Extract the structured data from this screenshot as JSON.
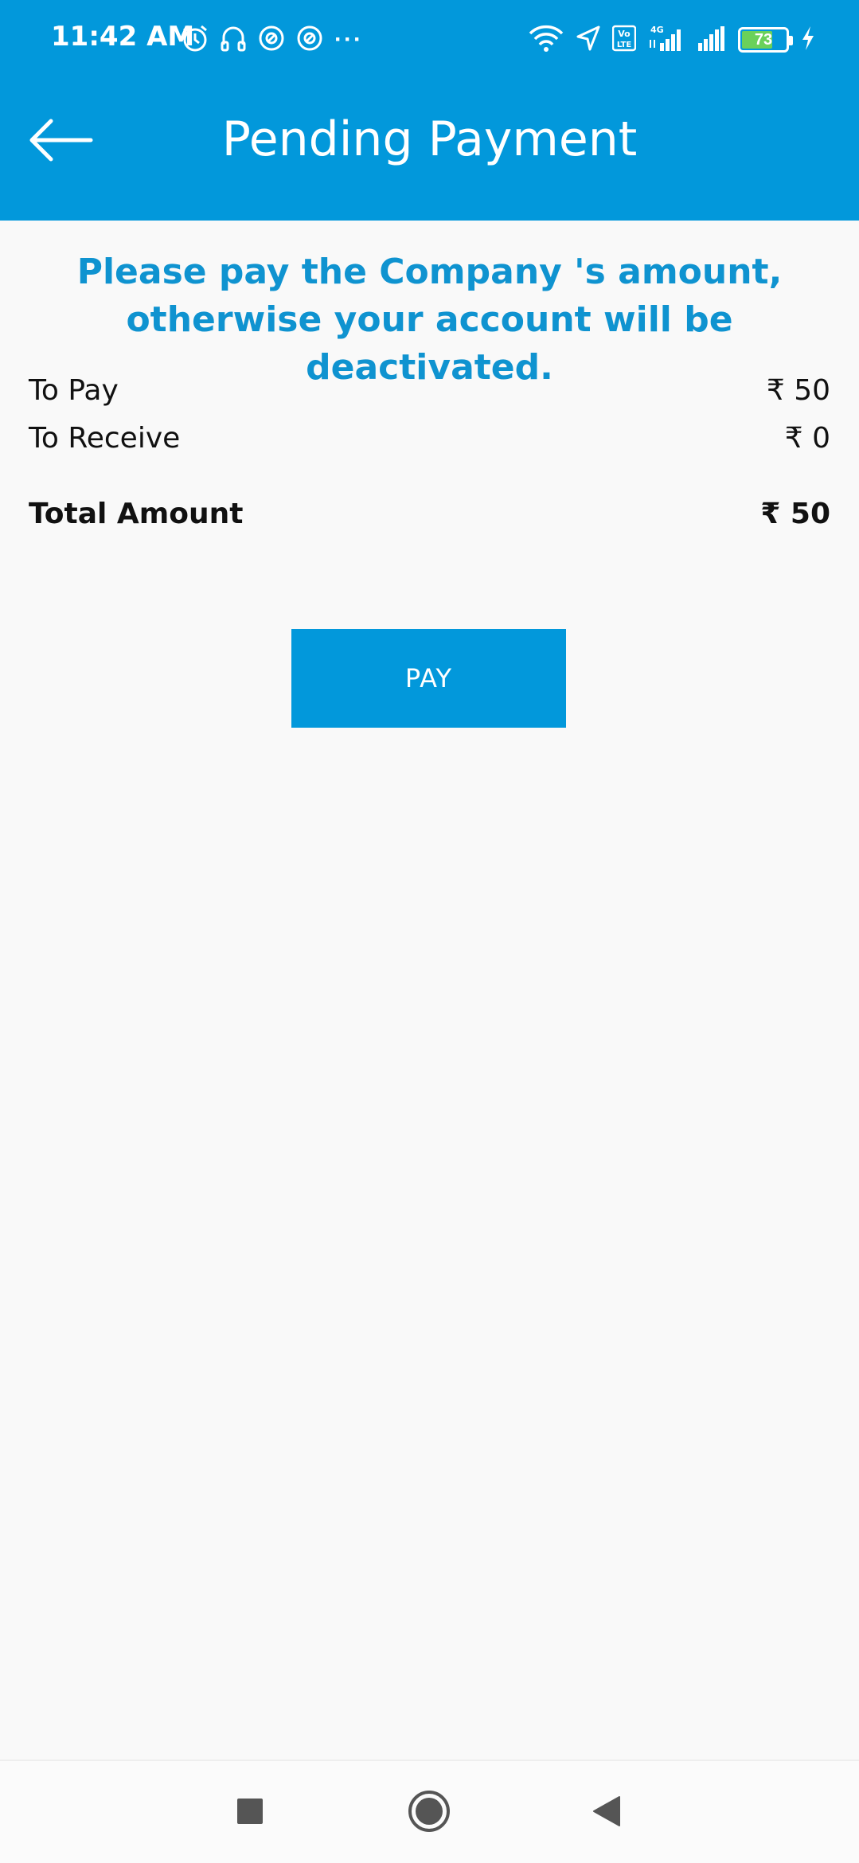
{
  "status_bar": {
    "time": "11:42 AM",
    "more": "···",
    "battery_level": "73",
    "battery_fraction": 0.73,
    "icons_left": [
      "alarm-icon",
      "headset-icon",
      "app-notification-icon",
      "app-notification-icon"
    ],
    "icons_right": [
      "wifi-icon",
      "location-icon",
      "volte-icon",
      "signal-4g-icon",
      "signal-icon",
      "battery-icon",
      "charging-icon"
    ],
    "volte_label": "Vo\nLTE",
    "network_label": "4G"
  },
  "header": {
    "title": "Pending Payment",
    "back_icon": "arrow-left-icon"
  },
  "message": "Please pay the Company 's amount, otherwise your account will be deactivated.",
  "summary": {
    "to_pay_label": "To Pay",
    "to_pay_value": "₹ 50",
    "to_receive_label": "To Receive",
    "to_receive_value": "₹ 0",
    "total_label": "Total Amount",
    "total_value": "₹ 50"
  },
  "pay_button_label": "PAY",
  "colors": {
    "primary": "#0298db",
    "message_text": "#0f93d0",
    "background": "#f9f9f9"
  },
  "nav_bar": {
    "icons": [
      "recent-apps-icon",
      "home-icon",
      "back-icon"
    ]
  }
}
